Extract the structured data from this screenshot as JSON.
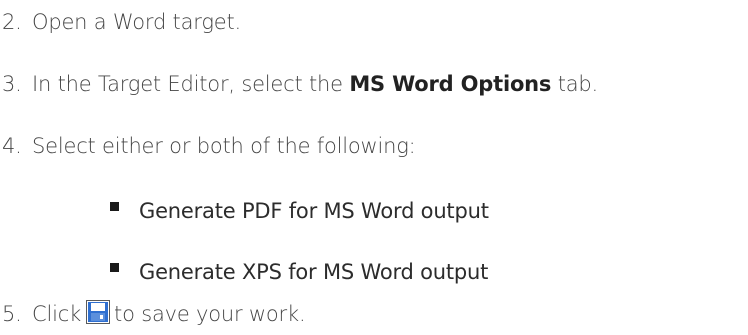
{
  "steps": [
    {
      "number": "2.",
      "text": "Open a Word target."
    },
    {
      "number": "3.",
      "text_before": "In the Target Editor, select the ",
      "bold": "MS Word Options",
      "text_after": " tab."
    },
    {
      "number": "4.",
      "text": "Select either or both of the following:"
    },
    {
      "number": "5.",
      "text_before": "Click",
      "icon": "save-icon",
      "text_after": "to save your work."
    }
  ],
  "sub_items": [
    "Generate PDF for MS Word output",
    "Generate XPS for MS Word output"
  ]
}
